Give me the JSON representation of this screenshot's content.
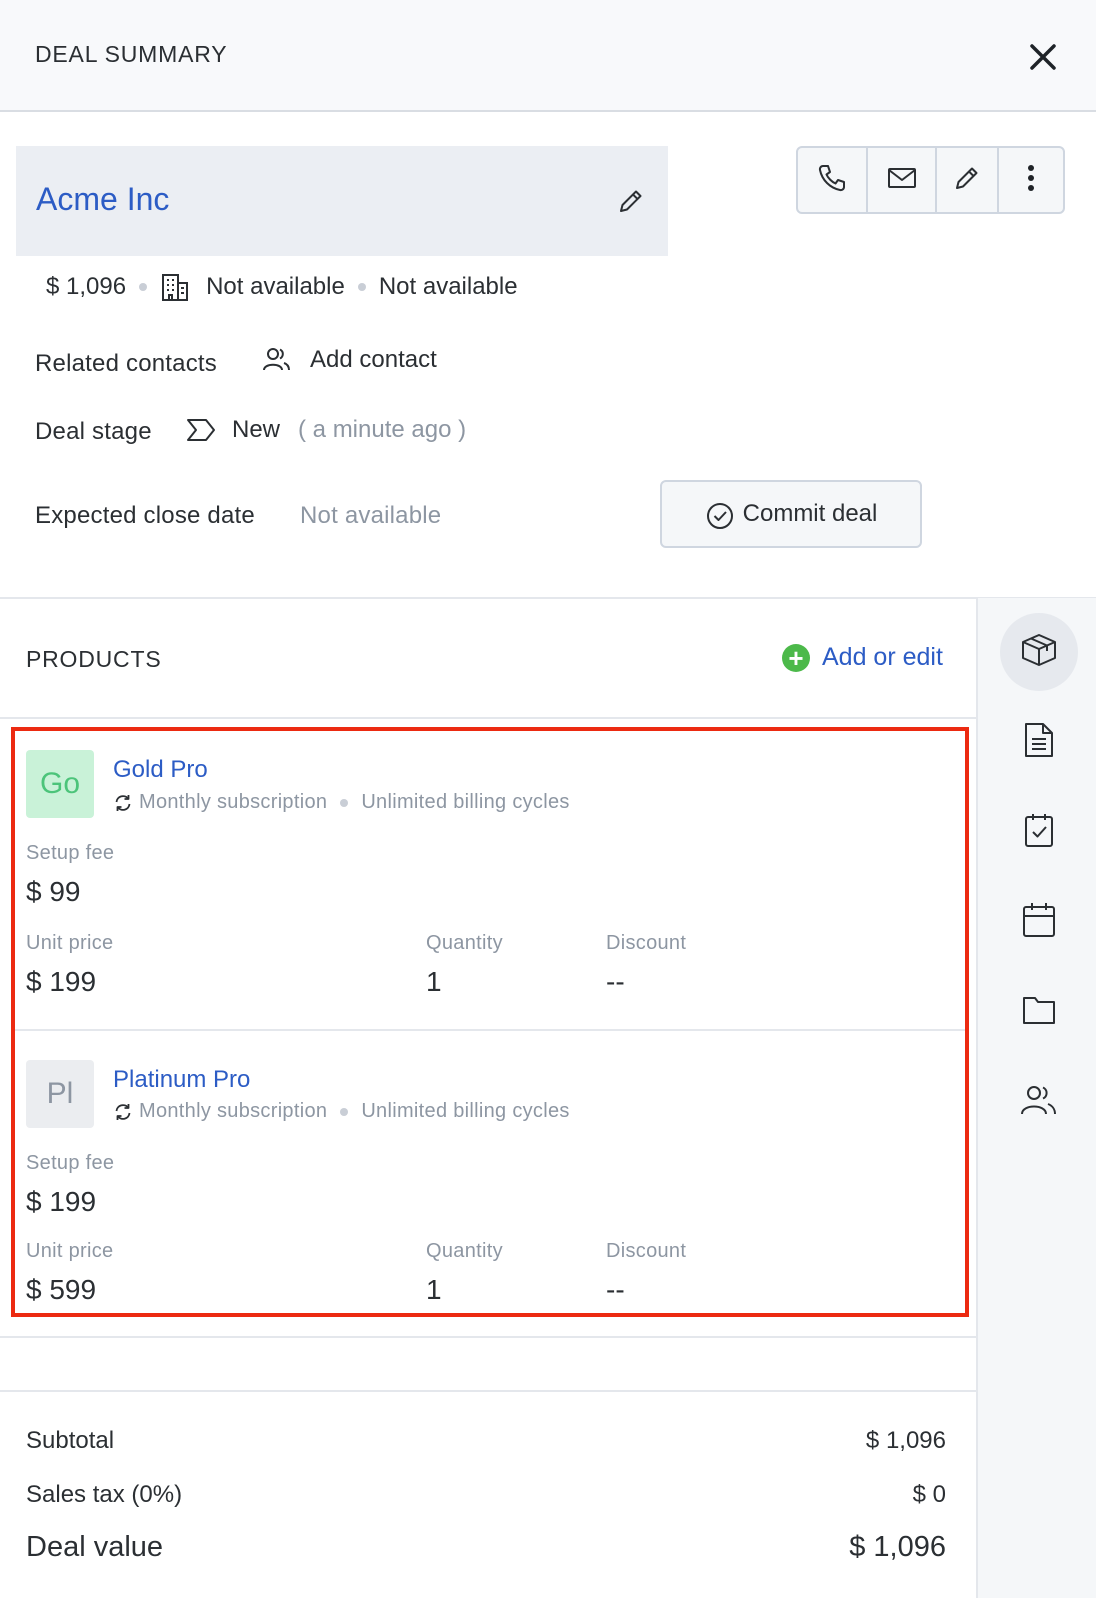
{
  "header": {
    "title": "DEAL SUMMARY"
  },
  "deal": {
    "name": "Acme Inc",
    "amount": "$ 1,096",
    "company": "Not available",
    "owner": "Not available"
  },
  "related_contacts": {
    "label": "Related contacts",
    "action": "Add contact"
  },
  "deal_stage": {
    "label": "Deal stage",
    "value": "New",
    "time": "( a minute ago )"
  },
  "close_date": {
    "label": "Expected close date",
    "value": "Not available"
  },
  "commit_button": "Commit deal",
  "products": {
    "title": "PRODUCTS",
    "add_edit": "Add or edit",
    "items": [
      {
        "initials": "Go",
        "name": "Gold Pro",
        "billing": "Monthly subscription",
        "cycles": "Unlimited billing cycles",
        "setup_fee_label": "Setup fee",
        "setup_fee": "$ 99",
        "unit_price_label": "Unit price",
        "unit_price": "$ 199",
        "quantity_label": "Quantity",
        "quantity": "1",
        "discount_label": "Discount",
        "discount": "--",
        "avatar_bg": "#c9f2d8",
        "avatar_fg": "#4cc47a"
      },
      {
        "initials": "Pl",
        "name": "Platinum Pro",
        "billing": "Monthly subscription",
        "cycles": "Unlimited billing cycles",
        "setup_fee_label": "Setup fee",
        "setup_fee": "$ 199",
        "unit_price_label": "Unit price",
        "unit_price": "$ 599",
        "quantity_label": "Quantity",
        "quantity": "1",
        "discount_label": "Discount",
        "discount": "--",
        "avatar_bg": "#ebedf0",
        "avatar_fg": "#8d96a2"
      }
    ]
  },
  "totals": {
    "subtotal_label": "Subtotal",
    "subtotal": "$ 1,096",
    "tax_label": "Sales tax (0%)",
    "tax": "$ 0",
    "deal_value_label": "Deal value",
    "deal_value": "$ 1,096"
  },
  "colors": {
    "accent": "#2c5cc5",
    "highlight": "#ec2a11",
    "add_green": "#4cb94a"
  }
}
